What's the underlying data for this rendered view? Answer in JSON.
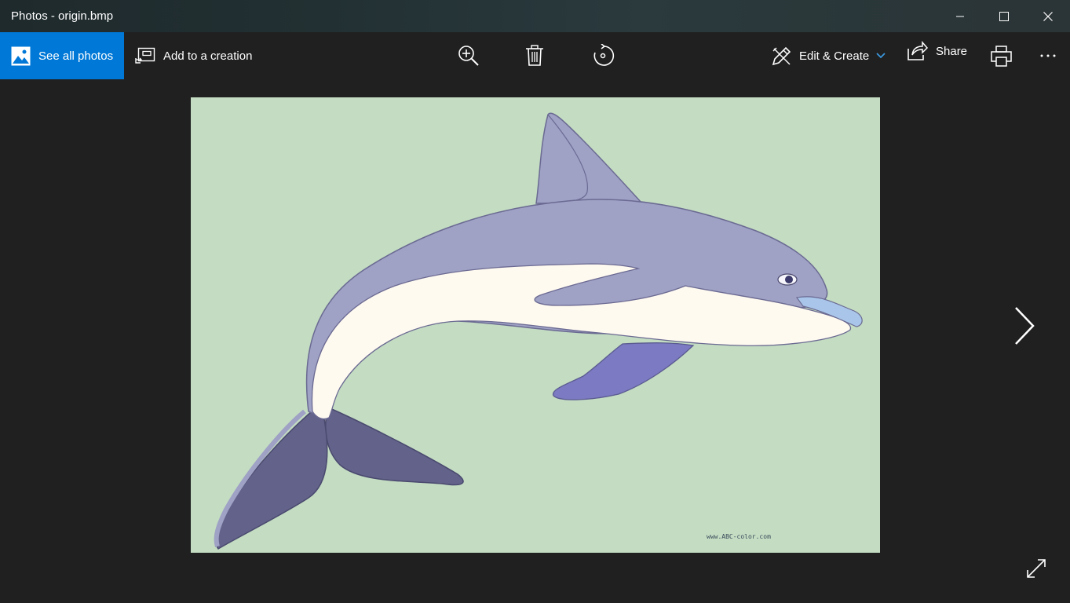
{
  "window": {
    "title": "Photos - origin.bmp"
  },
  "toolbar": {
    "see_all_label": "See all photos",
    "add_to_creation_label": "Add to a creation",
    "edit_create_label": "Edit & Create",
    "share_label": "Share"
  },
  "image": {
    "watermark": "www.ABC-color.com"
  },
  "colors": {
    "accent": "#0078d7",
    "background": "#202020",
    "image_background": "#c3dcc2",
    "dolphin_body": "#9fa1c5",
    "dolphin_belly": "#fffaf0",
    "dolphin_tail": "#63628a",
    "dolphin_fin": "#7b7ac2",
    "dolphin_beak": "#a9c6ea"
  },
  "icons": {
    "see_all": "gallery-icon",
    "add_to_creation": "add-to-creation-icon",
    "zoom": "zoom-in-icon",
    "delete": "trash-icon",
    "rotate": "rotate-icon",
    "edit": "edit-pencil-icon",
    "share": "share-icon",
    "print": "printer-icon",
    "more": "more-icon",
    "next": "chevron-right-icon",
    "fullscreen": "expand-icon"
  }
}
